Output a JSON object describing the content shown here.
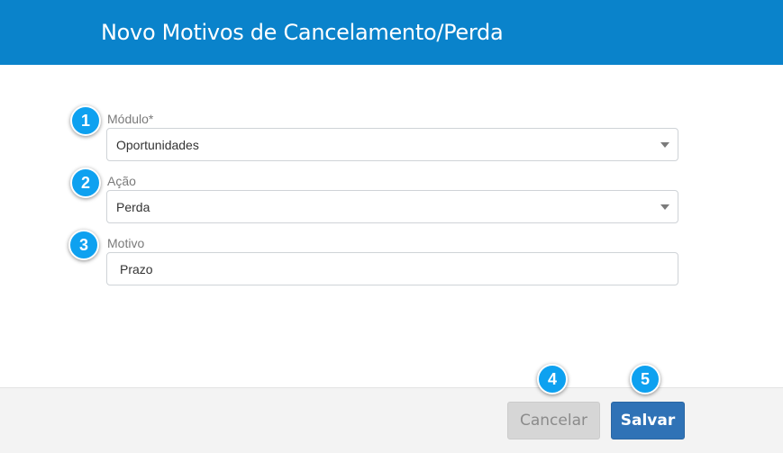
{
  "modal": {
    "title": "Novo Motivos de Cancelamento/Perda"
  },
  "form": {
    "modulo": {
      "label": "Módulo*",
      "value": "Oportunidades"
    },
    "acao": {
      "label": "Ação",
      "value": "Perda"
    },
    "motivo": {
      "label": "Motivo",
      "value": "Prazo"
    }
  },
  "badges": [
    "1",
    "2",
    "3",
    "4",
    "5"
  ],
  "footer": {
    "cancel_label": "Cancelar",
    "save_label": "Salvar"
  },
  "colors": {
    "header": "#0a83cb",
    "badge": "#0ea1f0",
    "save_button": "#2f72b6",
    "cancel_button": "#d6d6d6"
  },
  "icons": {
    "select_caret": "caret-down-icon"
  }
}
